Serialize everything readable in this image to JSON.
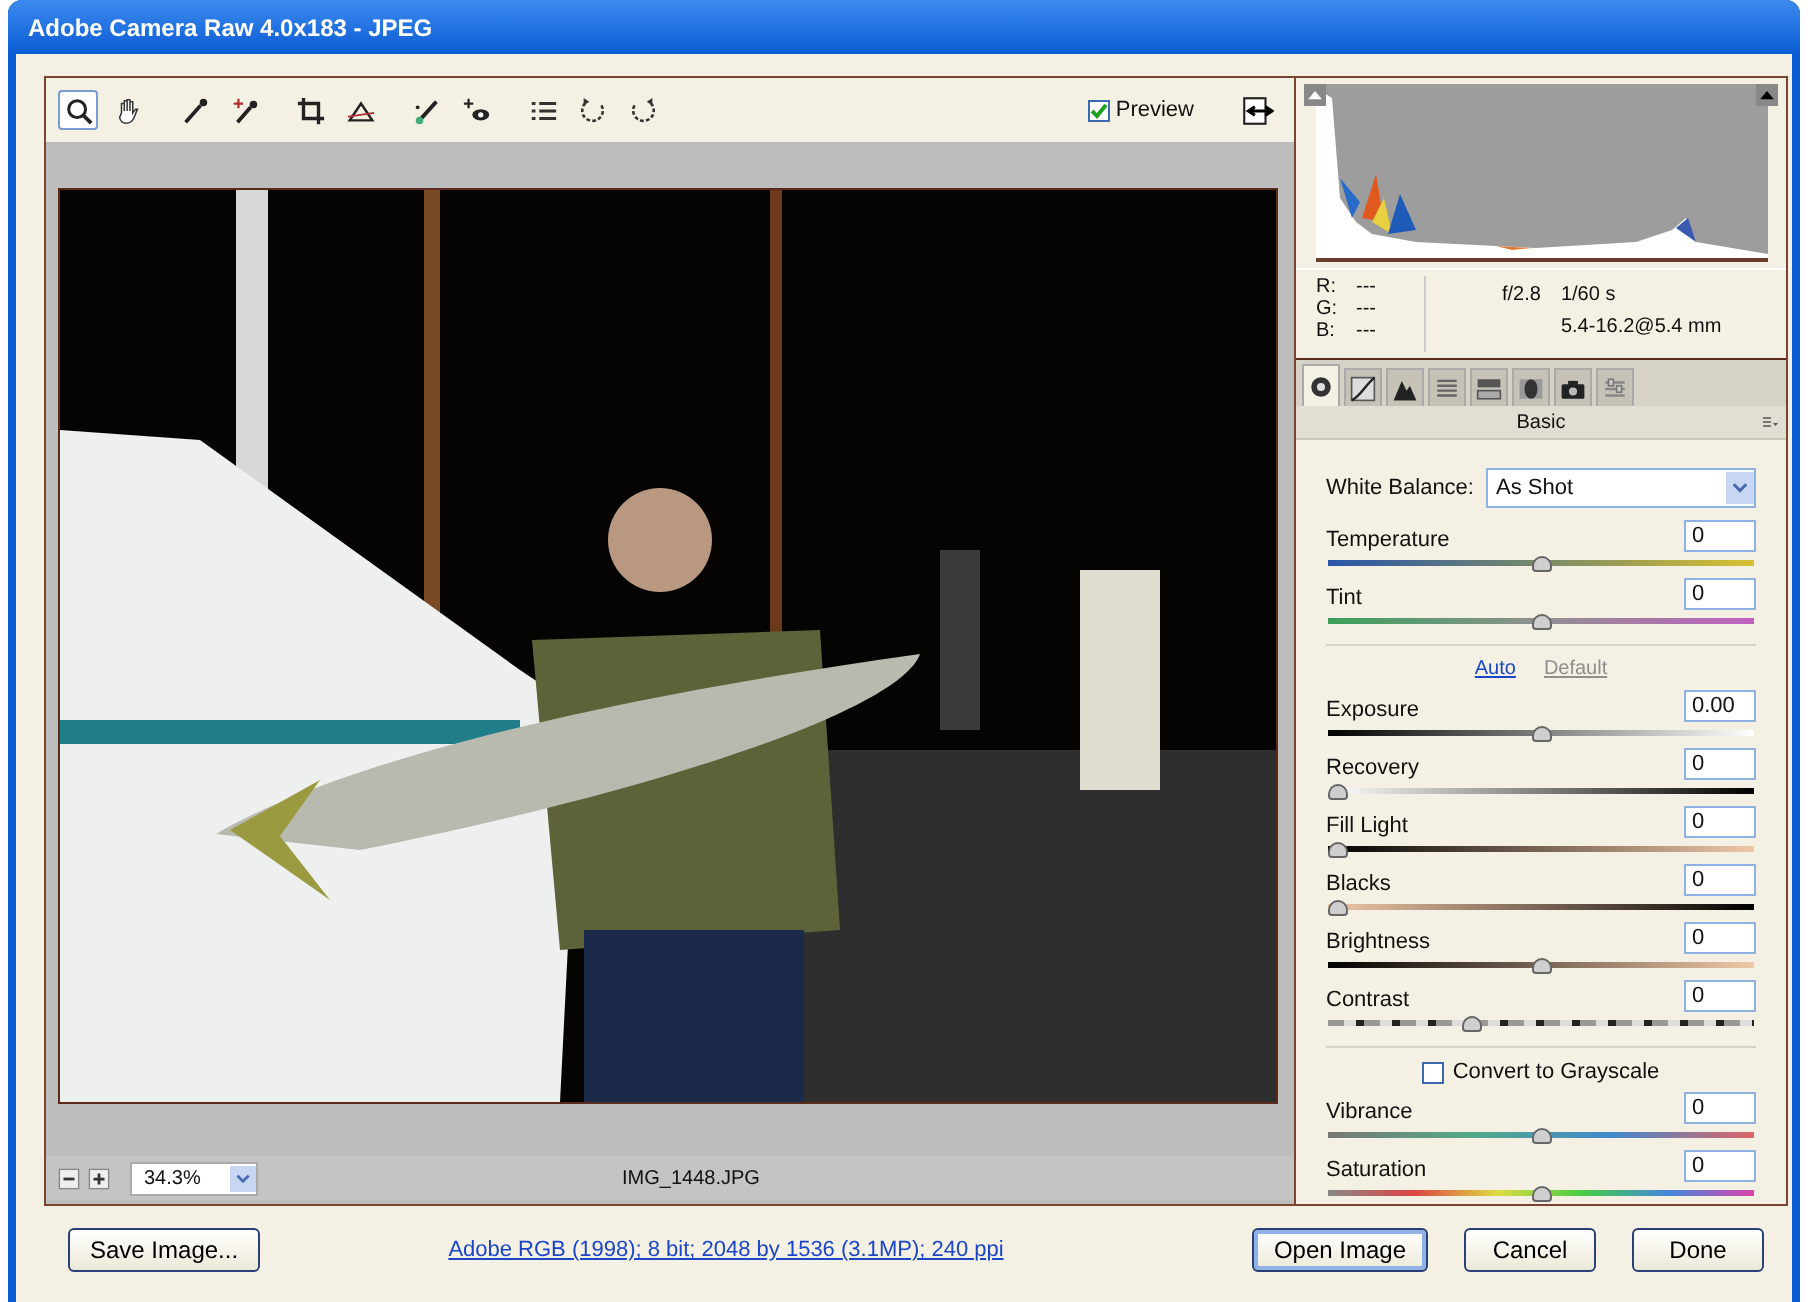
{
  "window": {
    "title": "Adobe Camera Raw 4.0x183  -  JPEG"
  },
  "toolbar": {
    "tools": [
      {
        "kind": "zoom",
        "selected": true
      },
      {
        "kind": "hand",
        "selected": false
      },
      {
        "kind": "eyedropper",
        "selected": false
      },
      {
        "kind": "sampler",
        "selected": false
      },
      {
        "kind": "crop",
        "selected": false
      },
      {
        "kind": "straighten",
        "selected": false
      },
      {
        "kind": "brush",
        "selected": false
      },
      {
        "kind": "eye",
        "selected": false
      },
      {
        "kind": "list",
        "selected": false
      },
      {
        "kind": "rotate-left",
        "selected": false
      },
      {
        "kind": "rotate-right",
        "selected": false
      }
    ],
    "preview": {
      "label": "Preview",
      "checked": true
    }
  },
  "status": {
    "zoom": "34.3%",
    "filename": "IMG_1448.JPG"
  },
  "info": {
    "rgb": [
      {
        "label": "R:",
        "value": "---"
      },
      {
        "label": "G:",
        "value": "---"
      },
      {
        "label": "B:",
        "value": "---"
      }
    ],
    "aperture": "f/2.8",
    "shutter": "1/60 s",
    "lens": "5.4-16.2@5.4 mm"
  },
  "panel_tabs": [
    {
      "kind": "aperture",
      "selected": true
    },
    {
      "kind": "curve",
      "selected": false
    },
    {
      "kind": "peaks",
      "selected": false
    },
    {
      "kind": "lines",
      "selected": false
    },
    {
      "kind": "bars",
      "selected": false
    },
    {
      "kind": "lens",
      "selected": false
    },
    {
      "kind": "camera",
      "selected": false
    },
    {
      "kind": "sliders",
      "selected": false
    }
  ],
  "panel_title": "Basic",
  "white_balance": {
    "label": "White Balance:",
    "value": "As Shot"
  },
  "wb_sliders": [
    {
      "name": "Temperature",
      "value": "0",
      "level": 0.5
    },
    {
      "name": "Tint",
      "value": "0",
      "level": 0.5
    }
  ],
  "auto_link": "Auto",
  "default_link": {
    "label": "Default",
    "disabled": true
  },
  "tone_sliders": [
    {
      "name": "Exposure",
      "value": "0.00",
      "level": 0.5
    },
    {
      "name": "Recovery",
      "value": "0",
      "level": 0
    },
    {
      "name": "Fill Light",
      "value": "0",
      "level": 0
    },
    {
      "name": "Blacks",
      "value": "0",
      "level": 0
    },
    {
      "name": "Brightness",
      "value": "0",
      "level": 0.5
    },
    {
      "name": "Contrast",
      "value": "0",
      "level": 0.33
    }
  ],
  "grayscale": {
    "label": "Convert to Grayscale",
    "checked": false
  },
  "presence_sliders": [
    {
      "name": "Vibrance",
      "value": "0",
      "level": 0.5
    },
    {
      "name": "Saturation",
      "value": "0",
      "level": 0.5
    }
  ],
  "footer": {
    "save": "Save Image...",
    "workflow": "Adobe RGB (1998); 8 bit; 2048 by 1536 (3.1MP); 240 ppi",
    "buttons": [
      {
        "label": "Open Image",
        "default": true
      },
      {
        "label": "Cancel",
        "default": false
      },
      {
        "label": "Done",
        "default": false
      }
    ]
  }
}
